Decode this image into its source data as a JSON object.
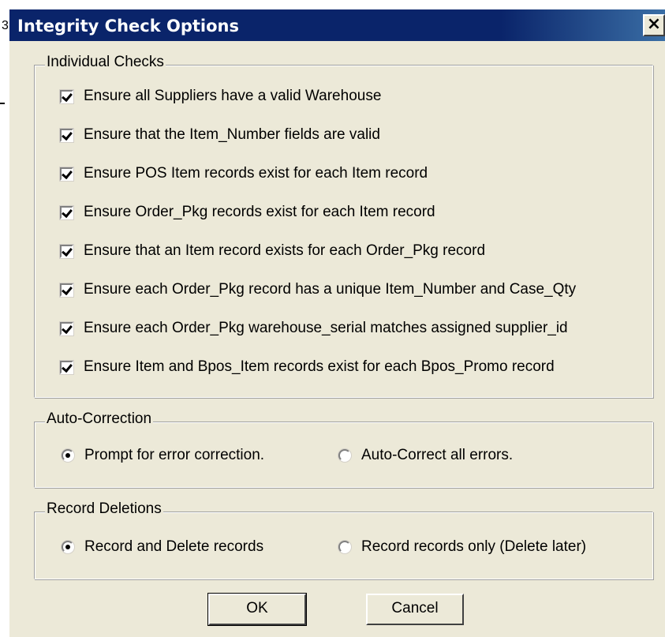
{
  "background_fragments": {
    "left_char": "3"
  },
  "dialog": {
    "title": "Integrity Check Options",
    "close_glyph": "×"
  },
  "individual_checks": {
    "label": "Individual Checks",
    "items": [
      {
        "label": "Ensure all Suppliers have a valid Warehouse",
        "checked": true
      },
      {
        "label": "Ensure that the Item_Number fields are valid",
        "checked": true
      },
      {
        "label": "Ensure POS Item records exist for each Item record",
        "checked": true
      },
      {
        "label": "Ensure Order_Pkg records exist for each Item record",
        "checked": true
      },
      {
        "label": "Ensure that an Item record exists for each Order_Pkg record",
        "checked": true
      },
      {
        "label": "Ensure each Order_Pkg record has a unique Item_Number and Case_Qty",
        "checked": true
      },
      {
        "label": "Ensure each Order_Pkg warehouse_serial matches assigned supplier_id",
        "checked": true
      },
      {
        "label": "Ensure Item and Bpos_Item records exist for each Bpos_Promo record",
        "checked": true
      }
    ]
  },
  "auto_correction": {
    "label": "Auto-Correction",
    "options": [
      {
        "label": "Prompt for error correction.",
        "selected": true
      },
      {
        "label": "Auto-Correct all errors.",
        "selected": false
      }
    ]
  },
  "record_deletions": {
    "label": "Record Deletions",
    "options": [
      {
        "label": "Record and Delete records",
        "selected": true
      },
      {
        "label": "Record records only (Delete later)",
        "selected": false
      }
    ]
  },
  "buttons": {
    "ok": "OK",
    "cancel": "Cancel"
  },
  "colors": {
    "title_bar": "#0a246a",
    "dialog_face": "#ece9d8"
  }
}
